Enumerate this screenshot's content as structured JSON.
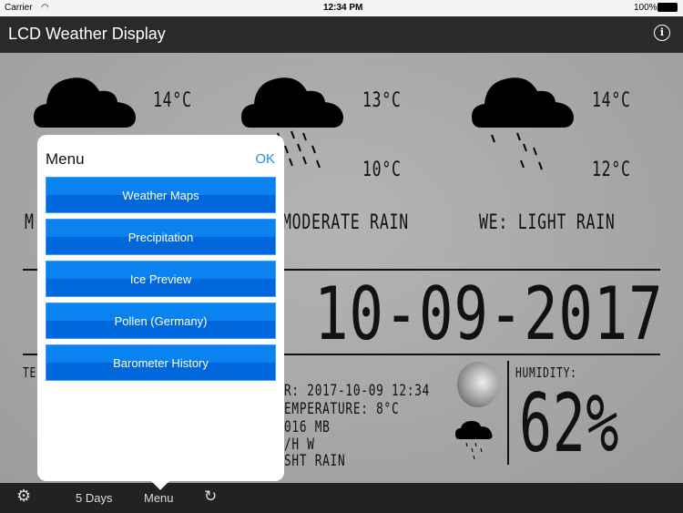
{
  "status": {
    "carrier": "Carrier",
    "time": "12:34 PM",
    "battery": "100%"
  },
  "nav": {
    "title": "LCD Weather Display",
    "info": "i"
  },
  "forecast": [
    {
      "high": "14°C",
      "low": "",
      "desc": "M"
    },
    {
      "high": "13°C",
      "low": "10°C",
      "desc": "MODERATE RAIN"
    },
    {
      "high": "14°C",
      "low": "12°C",
      "desc": "WE: LIGHT RAIN"
    }
  ],
  "date": "10-09-2017",
  "details": {
    "left_label": "TE",
    "lines": [
      "R: 2017-10-09 12:34",
      "EMPERATURE: 8°C",
      "016 MB",
      "/H W",
      "SHT RAIN"
    ]
  },
  "humidity": {
    "label": "HUMIDITY:",
    "value": "62%"
  },
  "menu": {
    "title": "Menu",
    "ok": "OK",
    "items": [
      "Weather Maps",
      "Precipitation",
      "Ice Preview",
      "Pollen (Germany)",
      "Barometer History"
    ]
  },
  "toolbar": {
    "days": "5 Days",
    "menu": "Menu"
  }
}
